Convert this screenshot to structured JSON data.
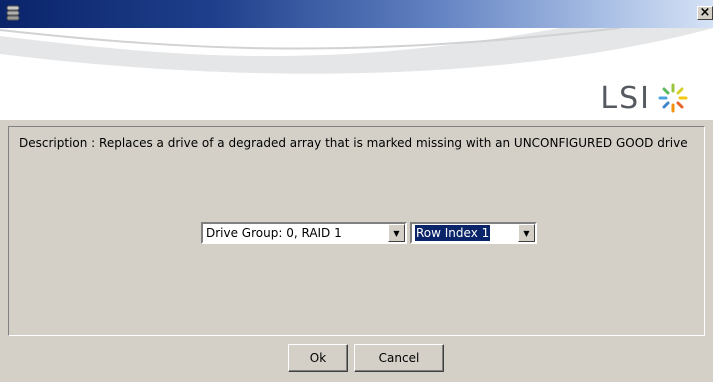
{
  "titlebar": {
    "title": "",
    "close_label": "×"
  },
  "banner": {
    "logo_text": "LSI"
  },
  "description": "Description : Replaces a drive of a degraded array that is marked missing with an UNCONFIGURED GOOD drive",
  "drive_group_select": {
    "value": "Drive Group: 0, RAID  1"
  },
  "row_index_select": {
    "value": "Row Index 1"
  },
  "buttons": {
    "ok": "Ok",
    "cancel": "Cancel"
  },
  "colors": {
    "title_start": "#0a246a",
    "title_end": "#d6e2f5",
    "dialog_bg": "#d4d0c8",
    "selection": "#0a246a"
  },
  "icons": {
    "app": "disk-stack-icon",
    "close": "close-icon",
    "logo": "lsi-starburst-icon",
    "dropdown": "chevron-down-icon"
  }
}
